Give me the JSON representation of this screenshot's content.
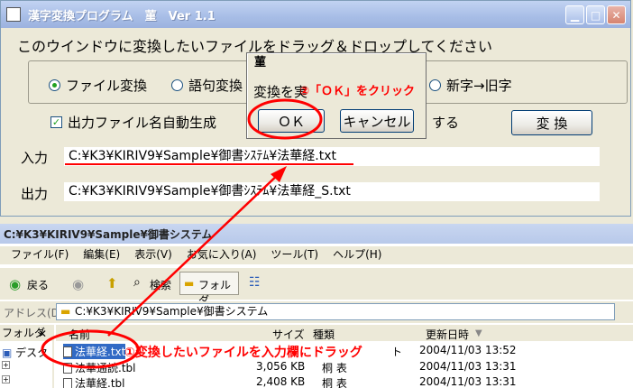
{
  "converter": {
    "title": "漢字変換プログラム　菫　Ver 1.1",
    "instruction": "このウインドウに変換したいファイルをドラッグ＆ドロップしてください",
    "modes": [
      "ファイル変換",
      "語句変換",
      "新字→旧字"
    ],
    "selected_mode": "ファイル変換",
    "auto_output_checkbox": "出力ファイル名自動生成",
    "auto_output_checked": true,
    "partial_label": "する",
    "convert_button": "変 換",
    "input_label": "入力",
    "input_value": "C:¥K3¥KIRIV9¥Sample¥御書ｼｽﾃﾑ¥法華経.txt",
    "output_label": "出力",
    "output_value": "C:¥K3¥KIRIV9¥Sample¥御書ｼｽﾃﾑ¥法華経_S.txt"
  },
  "dialog": {
    "title": "菫",
    "message": "変換を実",
    "ok_label": "ＯＫ",
    "cancel_label": "キャンセル"
  },
  "explorer": {
    "title": "C:¥K3¥KIRIV9¥Sample¥御書システム",
    "menu": [
      "ファイル(F)",
      "編集(E)",
      "表示(V)",
      "お気に入り(A)",
      "ツール(T)",
      "ヘルプ(H)"
    ],
    "back_label": "戻る",
    "search_label": "検索",
    "folders_label": "フォルダ",
    "address_label": "アドレス(D)",
    "address_value": "C:¥K3¥KIRIV9¥Sample¥御書システム",
    "folder_pane_label": "フォルダ",
    "folder_item": "デスク",
    "columns": [
      "名前",
      "サイズ",
      "種類",
      "更新日時"
    ],
    "files": [
      {
        "name": "法華経.txt",
        "size": "",
        "type": "ト",
        "date": "2004/11/03 13:52"
      },
      {
        "name": "法華通読.tbl",
        "size": "3,056 KB",
        "type": "桐 表",
        "date": "2004/11/03 13:31"
      },
      {
        "name": "法華経.tbl",
        "size": "2,408 KB",
        "type": "桐 表",
        "date": "2004/11/03 13:31"
      }
    ]
  },
  "annotations": {
    "step2": "②「ＯＫ」をクリック",
    "step1": "①変換したいファイルを入力欄にドラッグ"
  },
  "colors": {
    "annotation": "#ff0000",
    "titlebar": "#a7bde6",
    "window_bg": "#ece9d8"
  }
}
